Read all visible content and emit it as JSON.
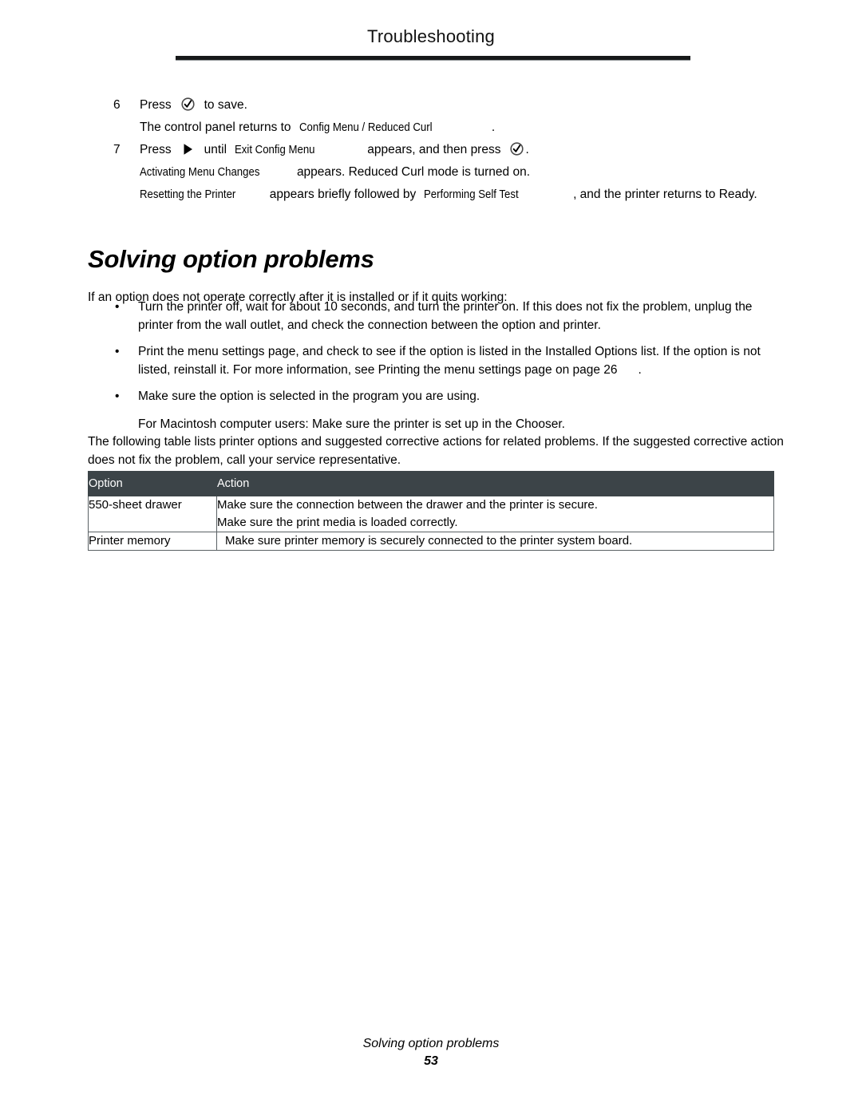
{
  "header": {
    "running_title": "Troubleshooting"
  },
  "steps": [
    {
      "number": "6",
      "press_label": "Press",
      "icon": "select-check-icon",
      "tail": "to save.",
      "sub_lead": "The control panel returns to",
      "sub_message": "Config Menu / Reduced Curl",
      "sub_tail": "."
    },
    {
      "number": "7",
      "press_label": "Press",
      "icon": "right-arrow-icon",
      "mid": "until",
      "message": "Exit Config Menu",
      "tail": "appears, and then press",
      "icon2": "select-check-icon",
      "end": "."
    }
  ],
  "step_notes": [
    {
      "message": "Activating Menu Changes",
      "text": "appears. Reduced Curl mode is turned on."
    },
    {
      "message": "Resetting the Printer",
      "text": "appears briefly followed by",
      "message2": "Performing Self Test",
      "text2": ", and the printer returns to Ready."
    }
  ],
  "section": {
    "heading": "Solving option problems",
    "intro": "If an option does not operate correctly after it is installed or if it quits working:",
    "bullets": [
      "Turn the printer off, wait for about 10 seconds, and turn the printer on. If this does not fix the problem, unplug the printer from the wall outlet, and check the connection between the option and printer.",
      "Print the menu settings page, and check to see if the option is listed in the Installed Options list. If the option is not listed, reinstall it. For more information, see Printing the menu settings page on page 26",
      "Make sure the option is selected in the program you are using."
    ],
    "bullet2_suffix": ".",
    "macintosh_note": "For Macintosh computer users: Make sure the printer is set up in the Chooser.",
    "outro": "The following table lists printer options and suggested corrective actions for related problems. If the suggested corrective action does not fix the problem, call your service representative."
  },
  "table": {
    "headers": [
      "Option",
      "Action"
    ],
    "rows": [
      {
        "option": "550-sheet drawer",
        "actions": [
          "Make sure the connection between the drawer and the printer is secure.",
          "Make sure the print media is loaded correctly."
        ]
      },
      {
        "option": "Printer memory",
        "actions": [
          "Make sure printer memory is securely connected to the printer system board."
        ]
      }
    ]
  },
  "footer": {
    "title": "Solving option problems",
    "page_number": "53"
  },
  "colors": {
    "table_header_bg": "#3c4448",
    "table_header_text": "#ffffff",
    "table_border": "#5a6164",
    "rule": "#17191a",
    "text": "#000000"
  }
}
